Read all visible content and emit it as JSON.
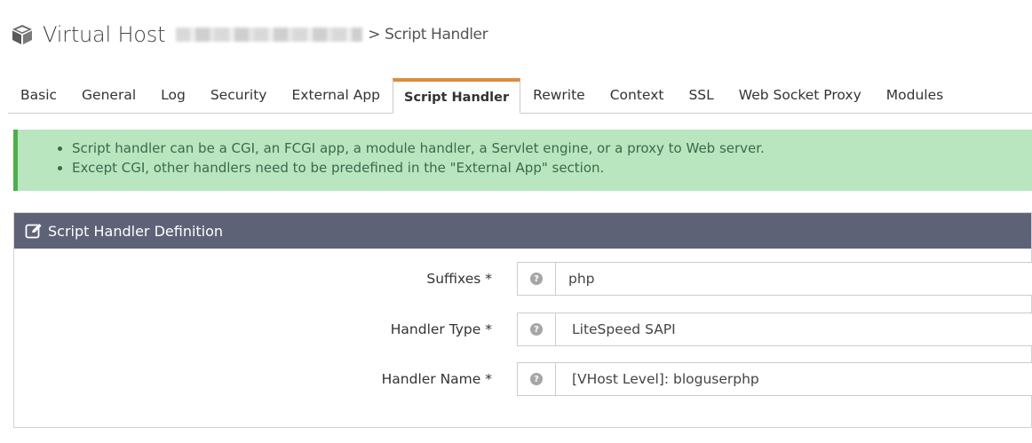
{
  "header": {
    "title": "Virtual Host",
    "subtitle": "> Script Handler",
    "icon": "cube-icon"
  },
  "tabs": [
    {
      "label": "Basic"
    },
    {
      "label": "General"
    },
    {
      "label": "Log"
    },
    {
      "label": "Security"
    },
    {
      "label": "External App"
    },
    {
      "label": "Script Handler",
      "active": true
    },
    {
      "label": "Rewrite"
    },
    {
      "label": "Context"
    },
    {
      "label": "SSL"
    },
    {
      "label": "Web Socket Proxy"
    },
    {
      "label": "Modules"
    }
  ],
  "info": {
    "items": [
      "Script handler can be a CGI, an FCGI app, a module handler, a Servlet engine, or a proxy to Web server.",
      "Except CGI, other handlers need to be predefined in the \"External App\" section."
    ],
    "accent_color": "#4cae4c",
    "background_color": "#b9e6bf"
  },
  "panel": {
    "title": "Script Handler Definition",
    "icon": "edit-icon",
    "header_color": "#5d6277",
    "fields": [
      {
        "label": "Suffixes *",
        "value": "php"
      },
      {
        "label": "Handler Type *",
        "value": "LiteSpeed SAPI"
      },
      {
        "label": "Handler Name *",
        "value": "[VHost Level]: bloguserphp"
      }
    ]
  },
  "colors": {
    "active_tab_accent": "#e08a3c"
  }
}
